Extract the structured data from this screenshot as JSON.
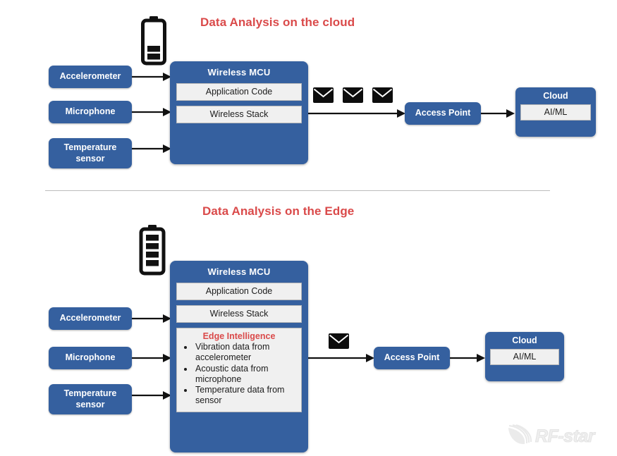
{
  "sections": [
    {
      "id": "cloud-analysis",
      "title": "Data Analysis on the cloud",
      "battery": {
        "name": "battery-low-icon",
        "bars_total": 4,
        "bars_filled": 2
      },
      "sensors": [
        {
          "label": "Accelerometer"
        },
        {
          "label": "Microphone"
        },
        {
          "label": "Temperature\nsensor"
        }
      ],
      "mcu": {
        "title": "Wireless MCU",
        "blocks": [
          {
            "label": "Application Code"
          },
          {
            "label": "Wireless Stack"
          }
        ]
      },
      "messages": {
        "icon": "envelope-icon",
        "count": 3
      },
      "access_point": {
        "label": "Access Point"
      },
      "cloud": {
        "title": "Cloud",
        "inner_label": "AI/ML"
      }
    },
    {
      "id": "edge-analysis",
      "title": "Data Analysis on the Edge",
      "battery": {
        "name": "battery-full-icon",
        "bars_total": 4,
        "bars_filled": 4
      },
      "sensors": [
        {
          "label": "Accelerometer"
        },
        {
          "label": "Microphone"
        },
        {
          "label": "Temperature\nsensor"
        }
      ],
      "mcu": {
        "title": "Wireless MCU",
        "blocks": [
          {
            "label": "Application Code"
          },
          {
            "label": "Wireless Stack"
          }
        ],
        "edge_panel": {
          "title": "Edge Intelligence",
          "bullets": [
            "Vibration data from accelerometer",
            "Acoustic data from microphone",
            "Temperature data from sensor"
          ]
        }
      },
      "messages": {
        "icon": "envelope-icon",
        "count": 1
      },
      "access_point": {
        "label": "Access Point"
      },
      "cloud": {
        "title": "Cloud",
        "inner_label": "AI/ML"
      }
    }
  ],
  "watermark": {
    "text": "RF-star",
    "icon": "rf-star-logo-icon"
  },
  "colors": {
    "brand_blue": "#35609f",
    "title_red": "#da4a4a",
    "inner_fill": "#f0f0f0",
    "inner_border": "#b8b8b8",
    "arrow_black": "#111111",
    "divider_gray": "#bcbcbc"
  }
}
